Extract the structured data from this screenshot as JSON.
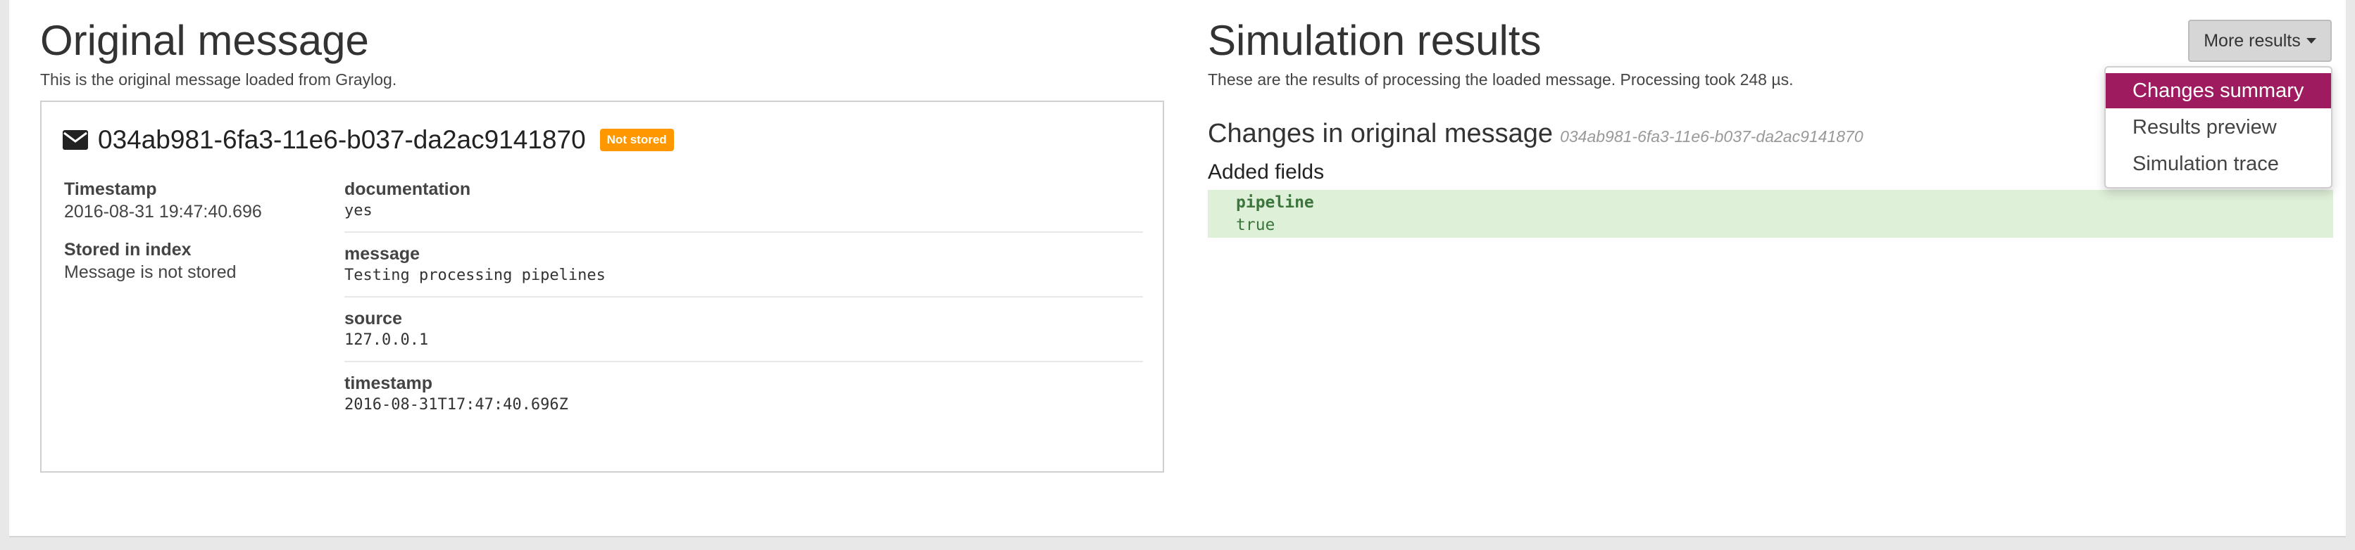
{
  "original": {
    "title": "Original message",
    "subtitle": "This is the original message loaded from Graylog.",
    "message_id": "034ab981-6fa3-11e6-b037-da2ac9141870",
    "badge": "Not stored",
    "meta": [
      {
        "label": "Timestamp",
        "value": "2016-08-31 19:47:40.696"
      },
      {
        "label": "Stored in index",
        "value": "Message is not stored"
      }
    ],
    "fields": [
      {
        "name": "documentation",
        "value": "yes"
      },
      {
        "name": "message",
        "value": "Testing processing pipelines"
      },
      {
        "name": "source",
        "value": "127.0.0.1"
      },
      {
        "name": "timestamp",
        "value": "2016-08-31T17:47:40.696Z"
      }
    ]
  },
  "simulation": {
    "title": "Simulation results",
    "subtitle": "These are the results of processing the loaded message. Processing took 248 µs.",
    "more_button": "More results",
    "menu": [
      "Changes summary",
      "Results preview",
      "Simulation trace"
    ],
    "changes_title": "Changes in original message",
    "changes_id": "034ab981-6fa3-11e6-b037-da2ac9141870",
    "added_label": "Added fields",
    "added": [
      {
        "name": "pipeline",
        "value": "true"
      }
    ]
  },
  "colors": {
    "badge": "#ff9800",
    "menu_active": "#9e1b5f",
    "added_bg": "#dff0d8",
    "added_text": "#3c763d"
  },
  "icons": {
    "message": "envelope-icon",
    "dropdown": "caret-down-icon"
  }
}
